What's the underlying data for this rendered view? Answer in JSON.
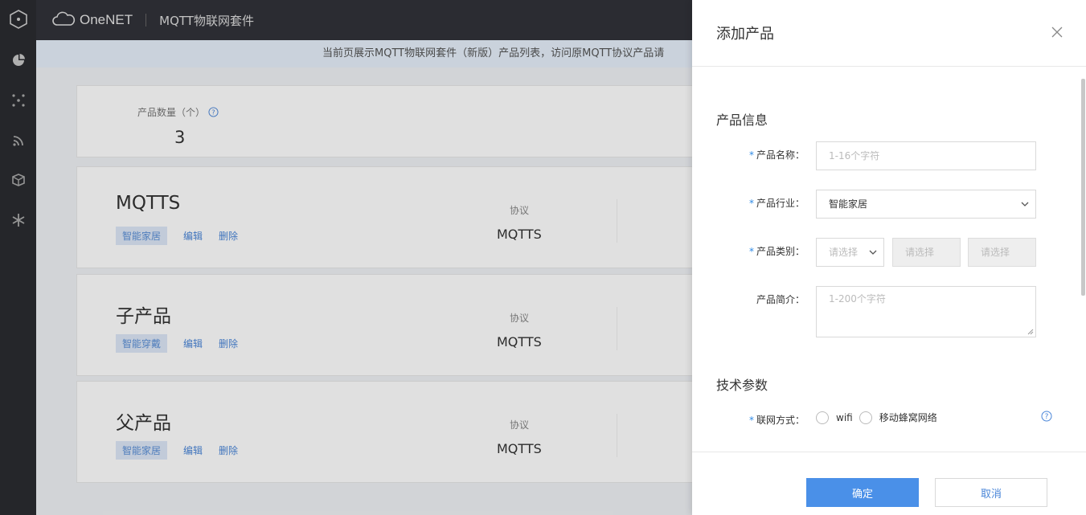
{
  "brand": {
    "name": "OneNET",
    "title": "MQTT物联网套件"
  },
  "notice": "当前页展示MQTT物联网套件（新版）产品列表，访问原MQTT协议产品请",
  "stats": {
    "label": "产品数量（个）",
    "value": "3"
  },
  "products": [
    {
      "name": "MQTTS",
      "tag": "智能家居",
      "edit": "编辑",
      "delete": "删除",
      "protocol_label": "协议",
      "protocol": "MQTTS"
    },
    {
      "name": "子产品",
      "tag": "智能穿戴",
      "edit": "编辑",
      "delete": "删除",
      "protocol_label": "协议",
      "protocol": "MQTTS"
    },
    {
      "name": "父产品",
      "tag": "智能家居",
      "edit": "编辑",
      "delete": "删除",
      "protocol_label": "协议",
      "protocol": "MQTTS"
    }
  ],
  "drawer": {
    "title": "添加产品",
    "section_info": "产品信息",
    "name_label": "产品名称：",
    "name_placeholder": "1-16个字符",
    "industry_label": "产品行业：",
    "industry_value": "智能家居",
    "category_label": "产品类别：",
    "category_placeholder_1": "请选择",
    "category_placeholder_2": "请选择",
    "category_placeholder_3": "请选择",
    "desc_label": "产品简介：",
    "desc_placeholder": "1-200个字符",
    "section_tech": "技术参数",
    "network_label": "联网方式：",
    "network_options": [
      "wifi",
      "移动蜂窝网络"
    ],
    "required_mark": "*",
    "confirm": "确定",
    "cancel": "取消"
  },
  "colors": {
    "accent": "#4a90e8",
    "sidebar": "#2b2c30",
    "topbar": "#323339",
    "required": "#2f8be6"
  }
}
